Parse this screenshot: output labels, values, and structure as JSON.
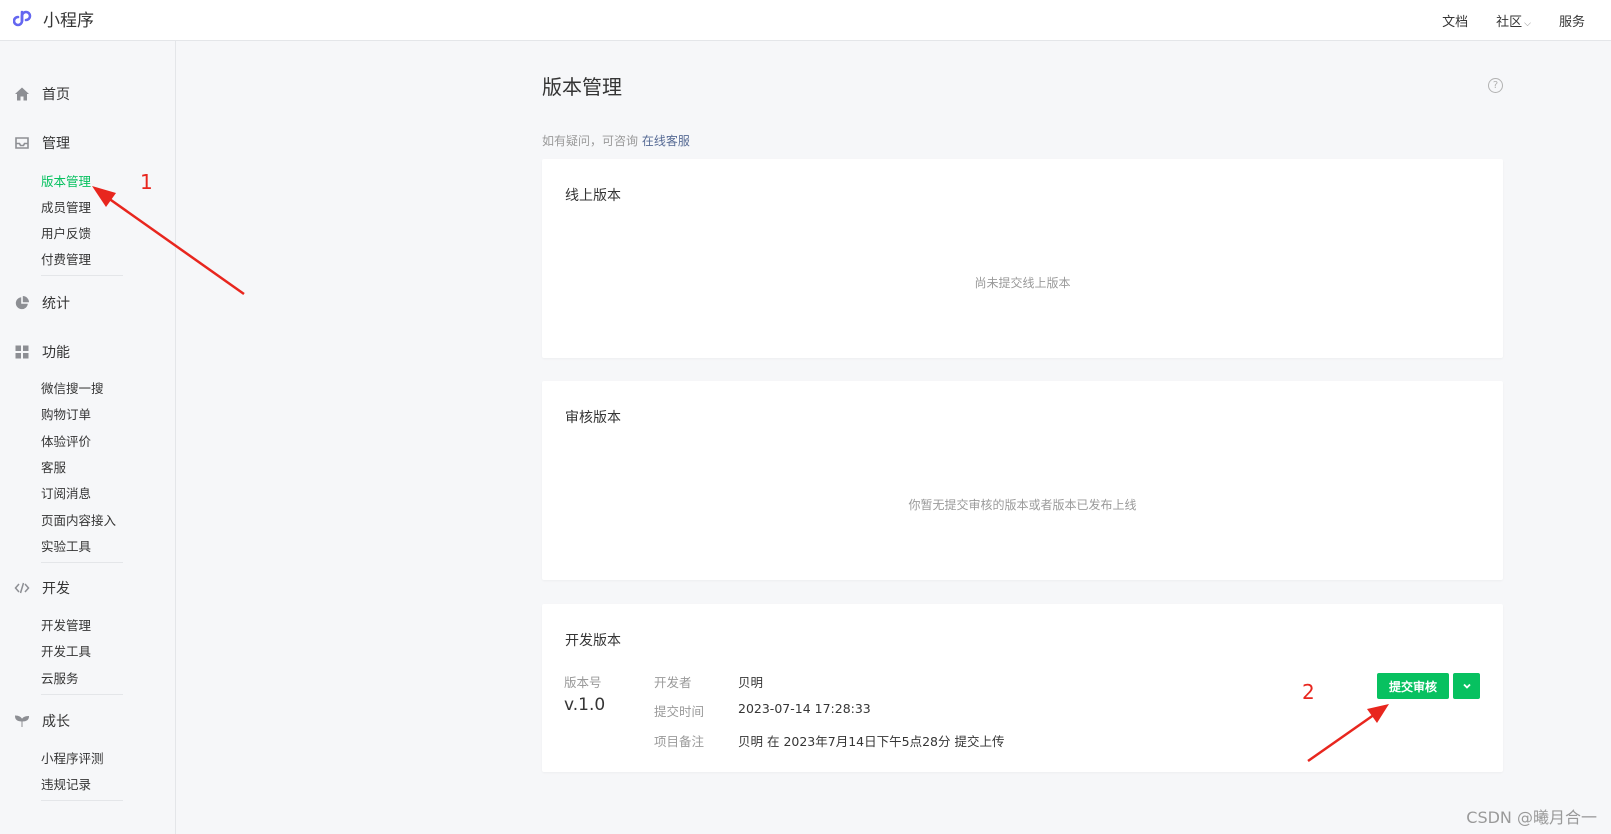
{
  "header": {
    "logo_text": "小程序",
    "nav": [
      "文档",
      "社区",
      "服务"
    ]
  },
  "sidebar": {
    "home": "首页",
    "manage": {
      "title": "管理",
      "items": [
        "版本管理",
        "成员管理",
        "用户反馈",
        "付费管理"
      ]
    },
    "stats": "统计",
    "features": {
      "title": "功能",
      "items": [
        "微信搜一搜",
        "购物订单",
        "体验评价",
        "客服",
        "订阅消息",
        "页面内容接入",
        "实验工具"
      ]
    },
    "dev": {
      "title": "开发",
      "items": [
        "开发管理",
        "开发工具",
        "云服务"
      ]
    },
    "growth": {
      "title": "成长",
      "items": [
        "小程序评测",
        "违规记录"
      ]
    }
  },
  "main": {
    "title": "版本管理",
    "help_icon": "?",
    "consult_prefix": "如有疑问，可咨询",
    "consult_link": "在线客服",
    "online": {
      "title": "线上版本",
      "empty": "尚未提交线上版本"
    },
    "review": {
      "title": "审核版本",
      "empty": "你暂无提交审核的版本或者版本已发布上线"
    },
    "develop": {
      "title": "开发版本",
      "version_label": "版本号",
      "version": "v.1.0",
      "developer_label": "开发者",
      "developer": "贝明",
      "time_label": "提交时间",
      "time": "2023-07-14 17:28:33",
      "note_label": "项目备注",
      "note": "贝明 在 2023年7月14日下午5点28分 提交上传",
      "submit_button": "提交审核"
    }
  },
  "annotations": {
    "one": "1",
    "two": "2"
  },
  "watermark": "CSDN @曦月合一",
  "colors": {
    "accent": "#07c160",
    "link": "#576b95",
    "annotation": "#e8261e"
  }
}
